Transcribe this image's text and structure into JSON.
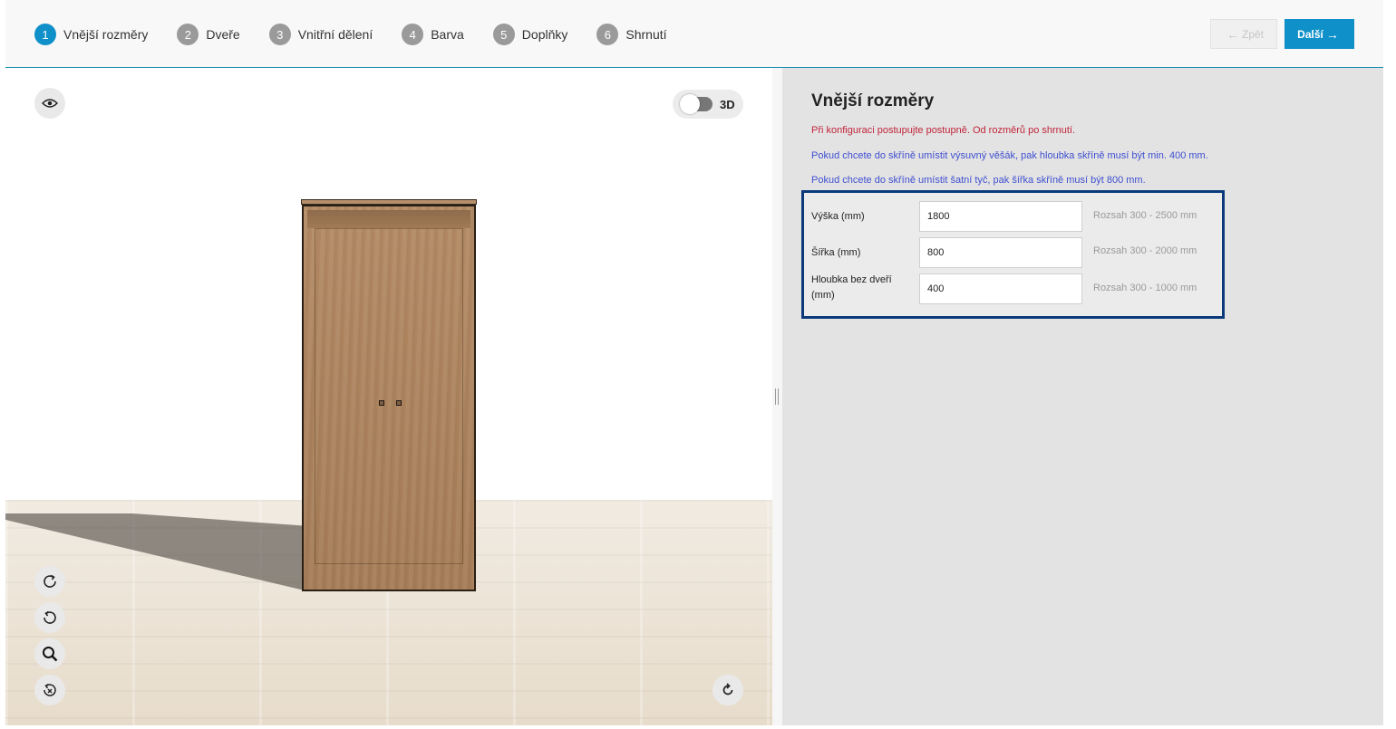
{
  "steps": [
    {
      "num": "1",
      "label": "Vnější rozměry"
    },
    {
      "num": "2",
      "label": "Dveře"
    },
    {
      "num": "3",
      "label": "Vnitřní dělení"
    },
    {
      "num": "4",
      "label": "Barva"
    },
    {
      "num": "5",
      "label": "Doplňky"
    },
    {
      "num": "6",
      "label": "Shrnutí"
    }
  ],
  "nav": {
    "back_label": "Zpět",
    "next_label": "Další"
  },
  "viewer": {
    "toggle_label": "3D",
    "toggle_on": false
  },
  "panel": {
    "title": "Vnější rozměry",
    "msg_red": "Při konfiguraci postupujte postupně. Od rozměrů po shrnutí.",
    "msg_blue1": "Pokud chcete do skříně umístit výsuvný věšák, pak hloubka skříně musí být min. 400 mm.",
    "msg_blue2": "Pokud chcete do skříně umístit šatní tyč, pak šířka skříně musí být 800 mm."
  },
  "form": {
    "height": {
      "label": "Výška (mm)",
      "value": "1800",
      "range": "Rozsah 300 - 2500 mm"
    },
    "width": {
      "label": "Šířka (mm)",
      "value": "800",
      "range": "Rozsah 300 - 2000 mm"
    },
    "depth": {
      "label": "Hloubka bez dveří (mm)",
      "value": "400",
      "range": "Rozsah 300 - 1000 mm"
    }
  },
  "colors": {
    "accent": "#0f90c9",
    "step_inactive": "#9a9a9a",
    "form_border": "#0b3a7b",
    "msg_red": "#c0243a",
    "msg_blue": "#3f4fd0"
  }
}
